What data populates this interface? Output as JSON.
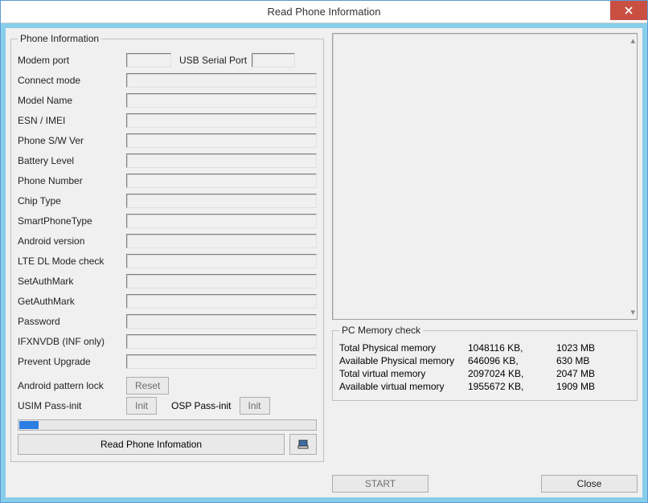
{
  "window": {
    "title": "Read Phone Information"
  },
  "phone_info": {
    "legend": "Phone Information",
    "modem_port_label": "Modem port",
    "modem_port_value": "",
    "usb_serial_label": "USB Serial Port",
    "usb_serial_value": "",
    "fields": [
      {
        "label": "Connect mode",
        "value": ""
      },
      {
        "label": "Model Name",
        "value": ""
      },
      {
        "label": "ESN / IMEI",
        "value": ""
      },
      {
        "label": "Phone S/W Ver",
        "value": ""
      },
      {
        "label": "Battery Level",
        "value": ""
      },
      {
        "label": "Phone Number",
        "value": ""
      },
      {
        "label": "Chip Type",
        "value": ""
      },
      {
        "label": "SmartPhoneType",
        "value": ""
      },
      {
        "label": "Android version",
        "value": ""
      },
      {
        "label": "LTE DL Mode check",
        "value": ""
      },
      {
        "label": "SetAuthMark",
        "value": ""
      },
      {
        "label": "GetAuthMark",
        "value": ""
      },
      {
        "label": "Password",
        "value": ""
      },
      {
        "label": "IFXNVDB (INF only)",
        "value": ""
      },
      {
        "label": "Prevent Upgrade",
        "value": ""
      }
    ],
    "pattern_lock_label": "Android pattern lock",
    "reset_btn": "Reset",
    "usim_pass_label": "USIM Pass-init",
    "usim_init_btn": "Init",
    "osp_pass_label": "OSP Pass-init",
    "osp_init_btn": "Init",
    "read_btn": "Read Phone Infomation"
  },
  "memory": {
    "legend": "PC Memory check",
    "rows": [
      {
        "label": "Total Physical memory",
        "kb": "1048116 KB,",
        "mb": "1023 MB"
      },
      {
        "label": "Available Physical memory",
        "kb": "646096 KB,",
        "mb": "630 MB"
      },
      {
        "label": "Total virtual memory",
        "kb": "2097024 KB,",
        "mb": "2047 MB"
      },
      {
        "label": "Available virtual memory",
        "kb": "1955672 KB,",
        "mb": "1909 MB"
      }
    ]
  },
  "buttons": {
    "start": "START",
    "close": "Close"
  }
}
